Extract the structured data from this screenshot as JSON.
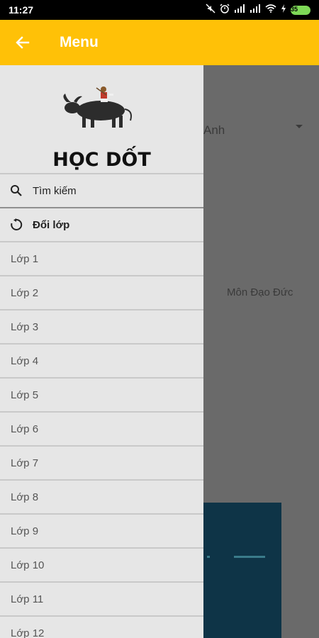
{
  "status_bar": {
    "time": "11:27",
    "battery": "35"
  },
  "app_bar": {
    "title": "Menu",
    "back_icon": "arrow-left-icon"
  },
  "background": {
    "dropdown_value": "Anh",
    "subject_label": "Môn Đạo Đức"
  },
  "drawer": {
    "brand": "HỌC DỐT",
    "actions": [
      {
        "label": "Tìm kiếm",
        "icon": "search-icon"
      },
      {
        "label": "Đổi lớp",
        "icon": "refresh-icon"
      }
    ],
    "grades": [
      "Lớp 1",
      "Lớp 2",
      "Lớp 3",
      "Lớp 4",
      "Lớp 5",
      "Lớp 6",
      "Lớp 7",
      "Lớp 8",
      "Lớp 9",
      "Lớp 10",
      "Lớp 11",
      "Lớp 12"
    ]
  },
  "colors": {
    "app_bar": "#ffc107",
    "drawer_bg": "#e6e6e6",
    "scrim": "#6a6a6a"
  }
}
